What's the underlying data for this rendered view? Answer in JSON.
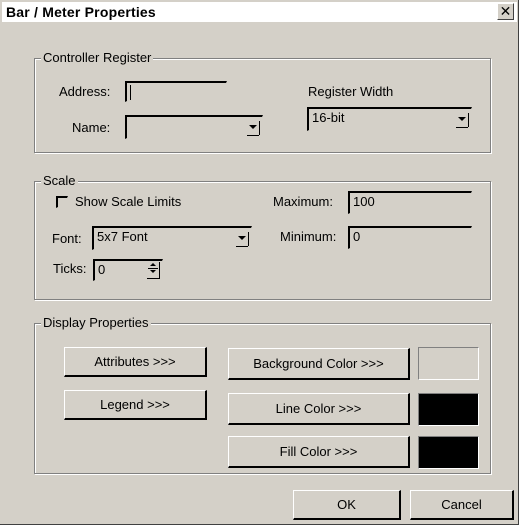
{
  "window": {
    "title": "Bar / Meter Properties",
    "close_glyph": "✕"
  },
  "controller_register": {
    "group_title": "Controller Register",
    "address_label": "Address:",
    "address_value": "",
    "name_label": "Name:",
    "name_value": "",
    "register_width_label": "Register Width",
    "register_width_value": "16-bit"
  },
  "scale": {
    "group_title": "Scale",
    "show_limits_label": "Show Scale Limits",
    "show_limits_checked": false,
    "font_label": "Font:",
    "font_value": "5x7 Font",
    "ticks_label": "Ticks:",
    "ticks_value": "0",
    "maximum_label": "Maximum:",
    "maximum_value": "100",
    "minimum_label": "Minimum:",
    "minimum_value": "0"
  },
  "display": {
    "group_title": "Display Properties",
    "attributes_button": "Attributes >>>",
    "legend_button": "Legend >>>",
    "background_color_button": "Background Color >>>",
    "line_color_button": "Line Color >>>",
    "fill_color_button": "Fill Color >>>",
    "background_color": "#d4d0c8",
    "line_color": "#000000",
    "fill_color": "#000000"
  },
  "footer": {
    "ok_button": "OK",
    "cancel_button": "Cancel"
  }
}
